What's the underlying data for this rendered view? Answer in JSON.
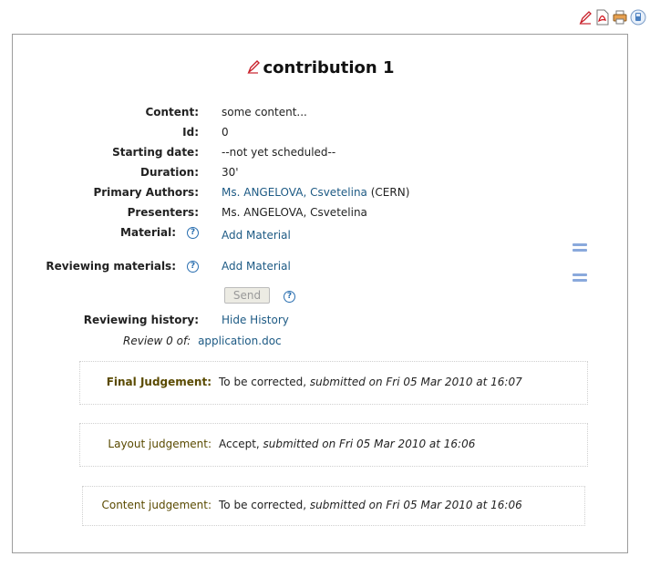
{
  "toolbar": {
    "icons": [
      "edit-icon",
      "pdf-icon",
      "print-icon",
      "ical-icon"
    ]
  },
  "title": "contribution 1",
  "fields": {
    "content": {
      "label": "Content:",
      "value": "some content..."
    },
    "id": {
      "label": "Id:",
      "value": "0"
    },
    "starting_date": {
      "label": "Starting date:",
      "value": "--not yet scheduled--"
    },
    "duration": {
      "label": "Duration:",
      "value": "30'"
    },
    "primary_authors": {
      "label": "Primary Authors:",
      "author": "Ms. ANGELOVA, Csvetelina",
      "affiliation": "(CERN)"
    },
    "presenters": {
      "label": "Presenters:",
      "value": "Ms. ANGELOVA, Csvetelina"
    },
    "material": {
      "label": "Material:",
      "link": "Add Material"
    },
    "reviewing_materials": {
      "label": "Reviewing materials:",
      "link": "Add Material"
    }
  },
  "send_label": "Send",
  "reviewing_history": {
    "label": "Reviewing history:",
    "link": "Hide History"
  },
  "review": {
    "prefix": "Review 0 of:",
    "file": "application.doc"
  },
  "judgements": [
    {
      "label": "Final Judgement:",
      "decision": "To be corrected,",
      "submitted": "submitted on Fri 05 Mar 2010 at 16:07"
    },
    {
      "label": "Layout judgement:",
      "decision": "Accept,",
      "submitted": "submitted on Fri 05 Mar 2010 at 16:06"
    },
    {
      "label": "Content judgement:",
      "decision": "To be corrected,",
      "submitted": "submitted on Fri 05 Mar 2010 at 16:06"
    }
  ],
  "colors": {
    "link": "#1d5a84",
    "help": "#2a6fb0",
    "judgement_label": "#5a4a00",
    "border": "#9c9c9c"
  }
}
